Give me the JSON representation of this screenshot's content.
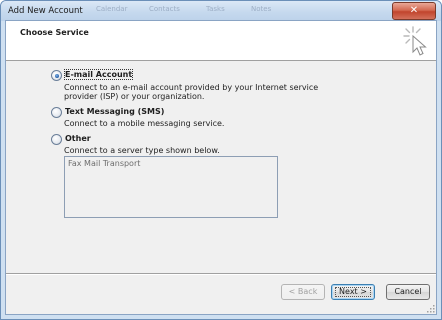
{
  "window": {
    "title": "Add New Account",
    "close_glyph": "✕",
    "background_taskbar_ghost": [
      "Calendar",
      "Contacts",
      "Tasks",
      "Notes"
    ]
  },
  "header": {
    "title": "Choose Service",
    "icon": "wizard-cursor-icon"
  },
  "options": [
    {
      "label": "E-mail Account",
      "selected": true,
      "description": "Connect to an e-mail account provided by your Internet service provider (ISP) or your organization."
    },
    {
      "label": "Text Messaging (SMS)",
      "selected": false,
      "description": "Connect to a mobile messaging service."
    },
    {
      "label": "Other",
      "selected": false,
      "description": "Connect to a server type shown below."
    }
  ],
  "server_list": {
    "items": [
      "Fax Mail Transport"
    ]
  },
  "buttons": {
    "back": "< Back",
    "next": "Next >",
    "cancel": "Cancel"
  },
  "colors": {
    "title_bar": "#c6d9ee",
    "close_button": "#c1452d",
    "dialog_face": "#f0f0f0",
    "header_panel": "#ffffff",
    "radio_selected": "#2a62a8"
  }
}
